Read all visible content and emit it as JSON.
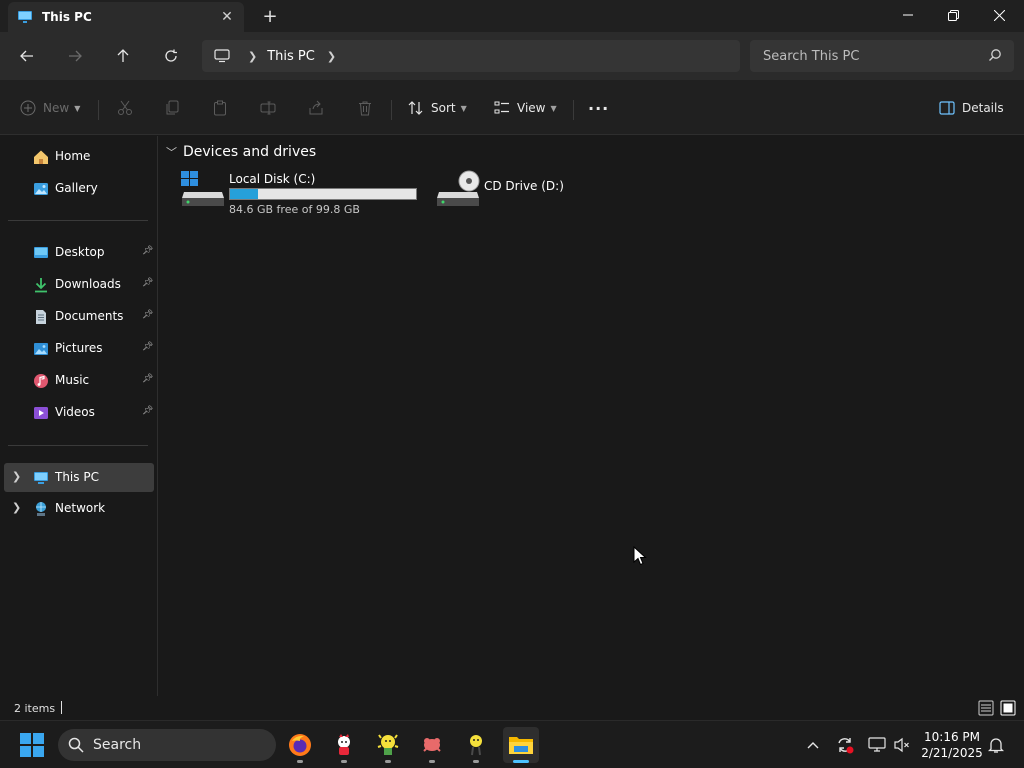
{
  "window": {
    "tab_title": "This PC",
    "tab_close": "✕",
    "new_tab": "+"
  },
  "address": {
    "root_icon": "computer-icon",
    "crumbs": [
      "This PC"
    ],
    "search_placeholder": "Search This PC"
  },
  "commands": {
    "new_label": "New",
    "sort_label": "Sort",
    "view_label": "View",
    "more_label": "···",
    "details_label": "Details",
    "disabled": [
      "cut",
      "copy",
      "paste",
      "rename",
      "share",
      "delete"
    ]
  },
  "sidebar": {
    "quick": [
      {
        "label": "Home",
        "icon": "home-icon"
      },
      {
        "label": "Gallery",
        "icon": "gallery-icon"
      }
    ],
    "pinned": [
      {
        "label": "Desktop",
        "icon": "desktop-icon"
      },
      {
        "label": "Downloads",
        "icon": "downloads-icon"
      },
      {
        "label": "Documents",
        "icon": "documents-icon"
      },
      {
        "label": "Pictures",
        "icon": "pictures-icon"
      },
      {
        "label": "Music",
        "icon": "music-icon"
      },
      {
        "label": "Videos",
        "icon": "videos-icon"
      }
    ],
    "roots": [
      {
        "label": "This PC",
        "icon": "this-pc-icon",
        "selected": true
      },
      {
        "label": "Network",
        "icon": "network-icon",
        "selected": false
      }
    ]
  },
  "content": {
    "group_title": "Devices and drives",
    "drives": [
      {
        "name": "Local Disk (C:)",
        "free_text": "84.6 GB free of 99.8 GB",
        "used_fraction": 0.152
      },
      {
        "name": "CD Drive (D:)"
      }
    ]
  },
  "status": {
    "item_count": "2 items"
  },
  "taskbar": {
    "search_label": "Search",
    "apps": [
      "firefox-icon",
      "app-icon",
      "app-icon",
      "app-icon",
      "app-icon",
      "file-explorer-icon"
    ],
    "time": "10:16 PM",
    "date": "2/21/2025"
  },
  "colors": {
    "accent": "#26a0da",
    "taskbar_active": "#4cc2ff",
    "folder_blue": "#3a9ee0"
  }
}
